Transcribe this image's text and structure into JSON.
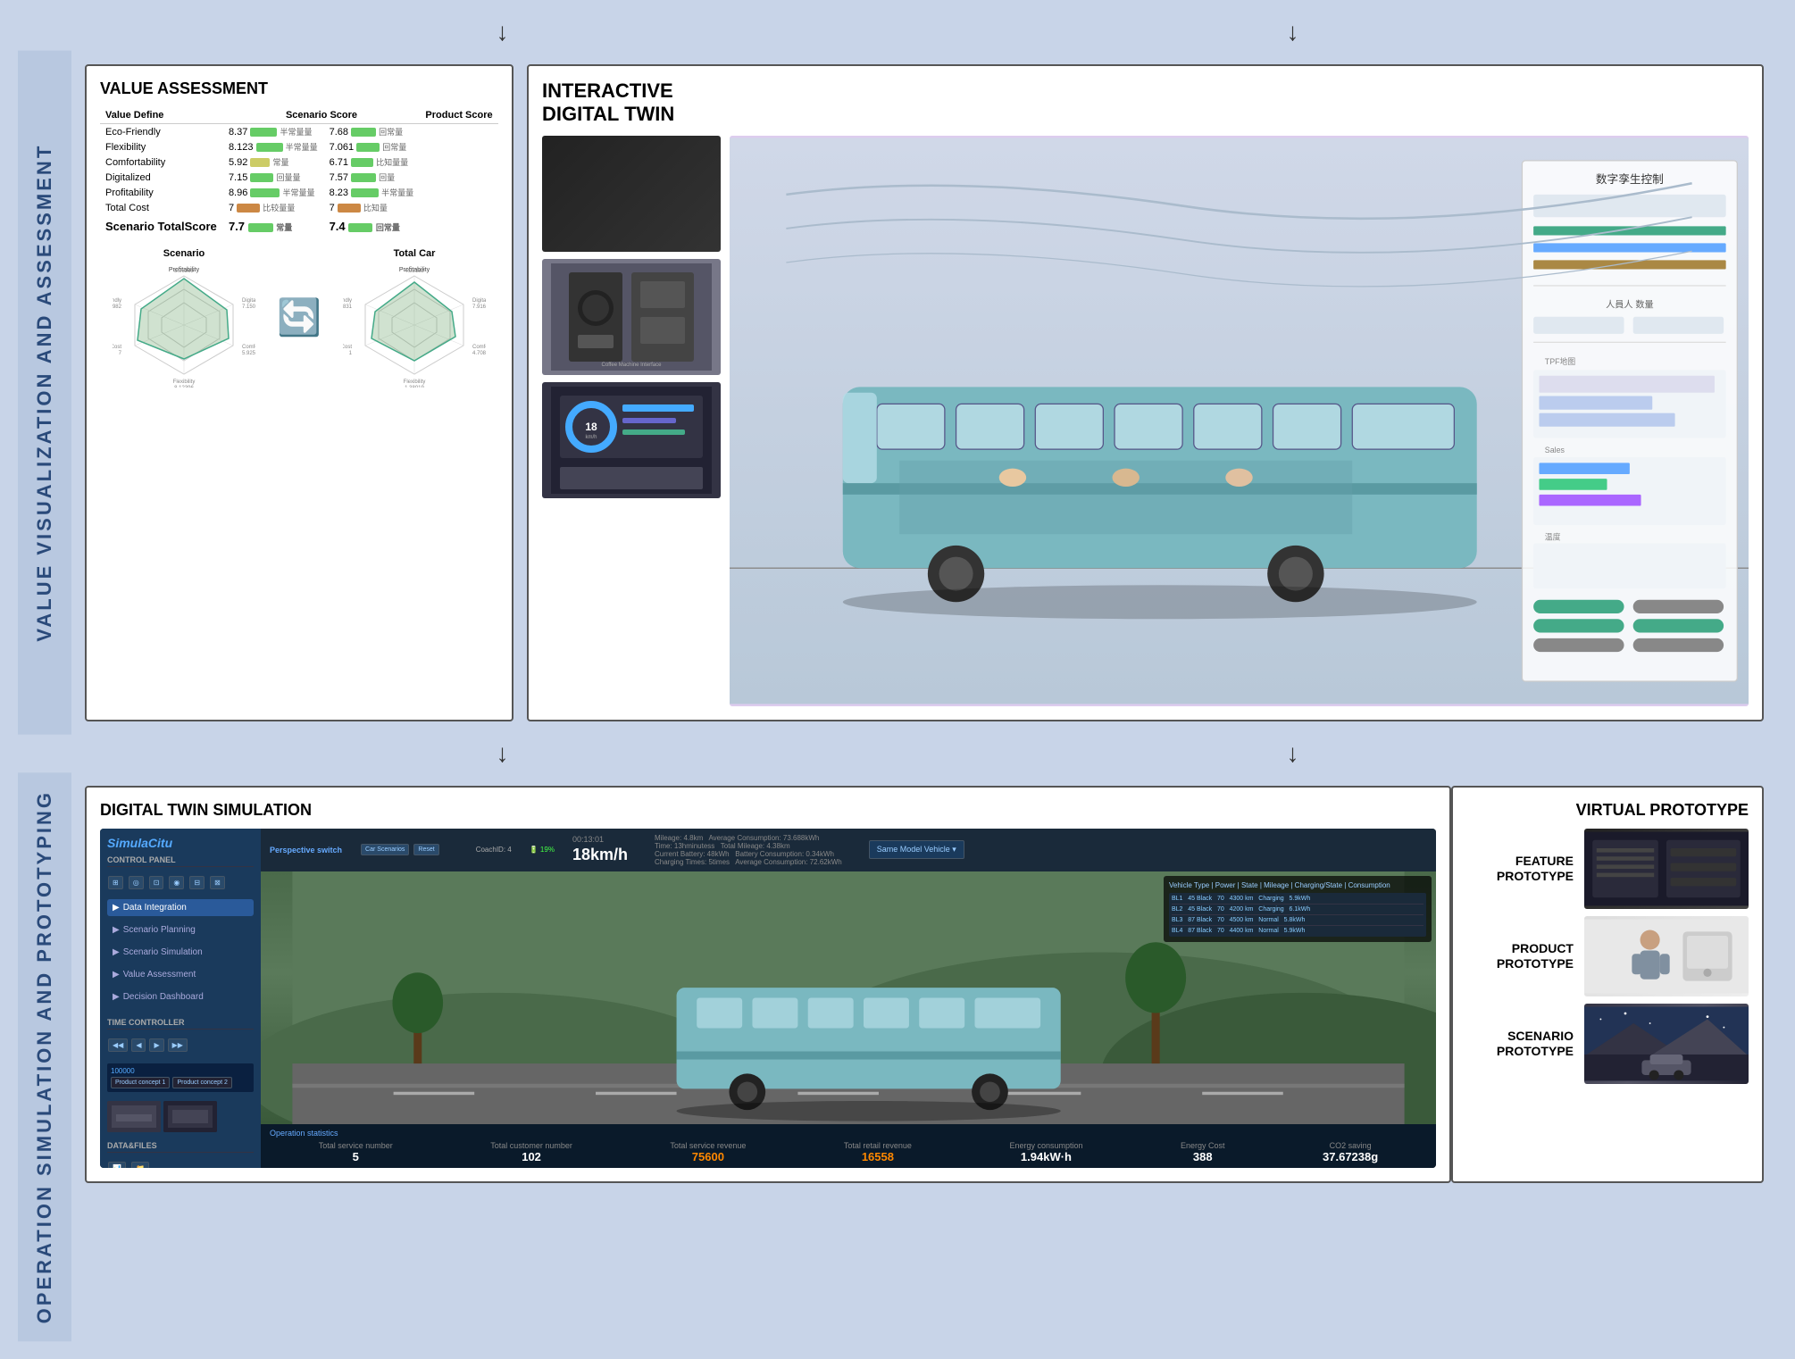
{
  "top_arrows": [
    "↓",
    "↓"
  ],
  "section_top": {
    "left_label": "VALUE VISUALIZATION AND ASSESSMENT",
    "value_assessment": {
      "title": "VALUE ASSESSMENT",
      "table": {
        "headers": [
          "Value Define",
          "Scenario Score",
          "",
          "Product Score",
          ""
        ],
        "rows": [
          {
            "name": "Eco-Friendly",
            "scenario_score": "8.37",
            "scenario_bar_color": "green",
            "scenario_label": "半常量量",
            "product_score": "7.68",
            "product_bar_color": "green",
            "product_label": "回常量"
          },
          {
            "name": "Flexibility",
            "scenario_score": "8.123",
            "scenario_bar_color": "green",
            "scenario_label": "半常量量",
            "product_score": "7.061",
            "product_bar_color": "green",
            "product_label": "回常量"
          },
          {
            "name": "Comfortability",
            "scenario_score": "5.92",
            "scenario_bar_color": "yellow",
            "scenario_label": "常量",
            "product_score": "6.71",
            "product_bar_color": "green",
            "product_label": "比知量量"
          },
          {
            "name": "Digitalized",
            "scenario_score": "7.15",
            "scenario_bar_color": "green",
            "scenario_label": "回量量",
            "product_score": "7.57",
            "product_bar_color": "green",
            "product_label": "回量"
          },
          {
            "name": "Profitability",
            "scenario_score": "8.96",
            "scenario_bar_color": "green",
            "scenario_label": "半常量量",
            "product_score": "8.23",
            "product_bar_color": "green",
            "product_label": "半常量量"
          },
          {
            "name": "Total Cost",
            "scenario_score": "7",
            "scenario_bar_color": "orange",
            "scenario_label": "比较量量",
            "product_score": "7",
            "product_bar_color": "orange",
            "product_label": "比知量"
          }
        ],
        "total": {
          "label": "Scenario TotalScore",
          "scenario_value": "7.7",
          "scenario_label": "常量",
          "product_value": "7.4",
          "product_label": "回常量"
        }
      },
      "radar_charts": [
        {
          "title": "Scenario",
          "labels": [
            "Profitability",
            "Digitalized",
            "Comfortability",
            "Flexibility",
            "Eco-Friendly",
            "Total Cost"
          ],
          "values": [
            8.96,
            7.15,
            5.92,
            8.123,
            8.37,
            7
          ]
        },
        {
          "title": "Total Car",
          "labels": [
            "Profitability",
            "Digitalized",
            "Comfortability",
            "Flexibility",
            "Eco-Friendly",
            "Total Cost"
          ],
          "values": [
            8.23,
            7.57,
            6.71,
            7.061,
            7.68,
            7
          ]
        }
      ]
    },
    "interactive_digital_twin": {
      "title": "INTERACTIVE\nDIGITAL TWIN",
      "description": "Interactive digital twin interface showing bus simulation"
    }
  },
  "between_arrows": [
    "↓",
    "↓"
  ],
  "section_bottom": {
    "left_label": "OPERATION SIMULATION AND PROTOTYPING",
    "digital_twin_simulation": {
      "title": "DIGITAL TWIN SIMULATION",
      "sim_ui": {
        "logo": "SimulaCitu",
        "control_panel_label": "Control panel",
        "perspective_switch_label": "Perspective switch",
        "nav_items": [
          "Data Integration",
          "Scenario Planning",
          "Scenario Simulation",
          "Value Assessment",
          "Decision Dashboard"
        ],
        "time_controller_label": "Time controller",
        "data_files_label": "Data&Files",
        "stats": {
          "coach_id": "4",
          "speed": "18km/h",
          "time": "00:13:01",
          "mileage": "4.8km",
          "total_mileage": "4.38km",
          "avg_consumption": "73.688kWh",
          "current_battery": "48kWh",
          "battery_consumption": "0.34kWh",
          "charging_times": "5times",
          "avg_consumption2": "72.62kWh"
        }
      },
      "bottom_stats": [
        {
          "label": "Total service number",
          "value": "5",
          "highlight": false
        },
        {
          "label": "Total customer number",
          "value": "102",
          "highlight": false
        },
        {
          "label": "Total service revenue",
          "value": "75600",
          "highlight": true
        },
        {
          "label": "Total retail revenue",
          "value": "16558",
          "highlight": true
        },
        {
          "label": "Energy consumption",
          "value": "1.94kW·h",
          "highlight": false
        },
        {
          "label": "Energy Cost",
          "value": "388",
          "highlight": false
        },
        {
          "label": "CO2 saving",
          "value": "37.67238g",
          "highlight": false
        }
      ]
    },
    "virtual_prototype": {
      "title": "VIRTUAL PROTOTYPE",
      "items": [
        {
          "label": "FEATURE\nPROTOTYPE",
          "type": "dark"
        },
        {
          "label": "PRODUCT\nPROTOTYPE",
          "type": "light"
        },
        {
          "label": "SCENARIO\nPROTOTYPE",
          "type": "scene"
        }
      ]
    }
  }
}
